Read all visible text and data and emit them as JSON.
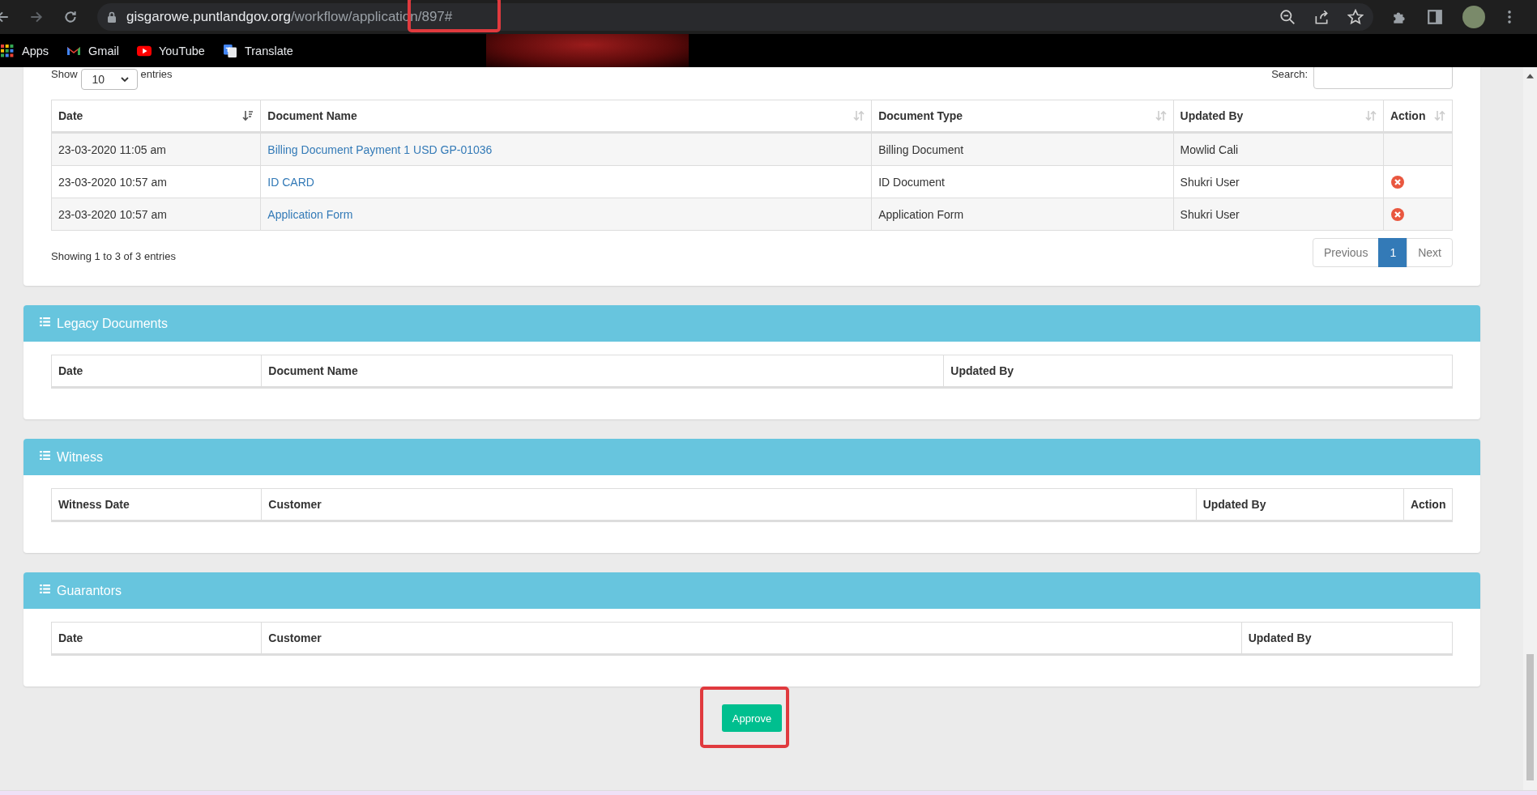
{
  "browser": {
    "url_host": "gisgarowe.puntlandgov.org",
    "url_path": "/workflow/application/897#",
    "bookmarks": [
      {
        "label": "Apps",
        "kind": "apps"
      },
      {
        "label": "Gmail",
        "kind": "gmail"
      },
      {
        "label": "YouTube",
        "kind": "youtube"
      },
      {
        "label": "Translate",
        "kind": "translate"
      }
    ]
  },
  "documents": {
    "length_label_before": "Show",
    "length_value": "10",
    "length_label_after": "entries",
    "search_label": "Search:",
    "columns": [
      {
        "label": "Date",
        "sorted": true
      },
      {
        "label": "Document Name",
        "sorted": false
      },
      {
        "label": "Document Type",
        "sorted": false
      },
      {
        "label": "Updated By",
        "sorted": false
      },
      {
        "label": "Action",
        "sorted": false
      }
    ],
    "rows": [
      {
        "date": "23-03-2020 11:05 am",
        "name": "Billing Document Payment 1 USD GP-01036",
        "type": "Billing Document",
        "updated_by": "Mowlid Cali",
        "deletable": false
      },
      {
        "date": "23-03-2020 10:57 am",
        "name": "ID CARD",
        "type": "ID Document",
        "updated_by": "Shukri User",
        "deletable": true
      },
      {
        "date": "23-03-2020 10:57 am",
        "name": "Application Form",
        "type": "Application Form",
        "updated_by": "Shukri User",
        "deletable": true
      }
    ],
    "info": "Showing 1 to 3 of 3 entries",
    "pagination": [
      {
        "label": "Previous",
        "selected": false
      },
      {
        "label": "1",
        "selected": true
      },
      {
        "label": "Next",
        "selected": false
      }
    ]
  },
  "sections": [
    {
      "title": "Legacy Documents",
      "columns": [
        "Date",
        "Document Name",
        "Updated By"
      ]
    },
    {
      "title": "Witness",
      "columns": [
        "Witness Date",
        "Customer",
        "Updated By",
        "Action"
      ]
    },
    {
      "title": "Guarantors",
      "columns": [
        "Date",
        "Customer",
        "Updated By"
      ]
    }
  ],
  "approve_button": "Approve"
}
